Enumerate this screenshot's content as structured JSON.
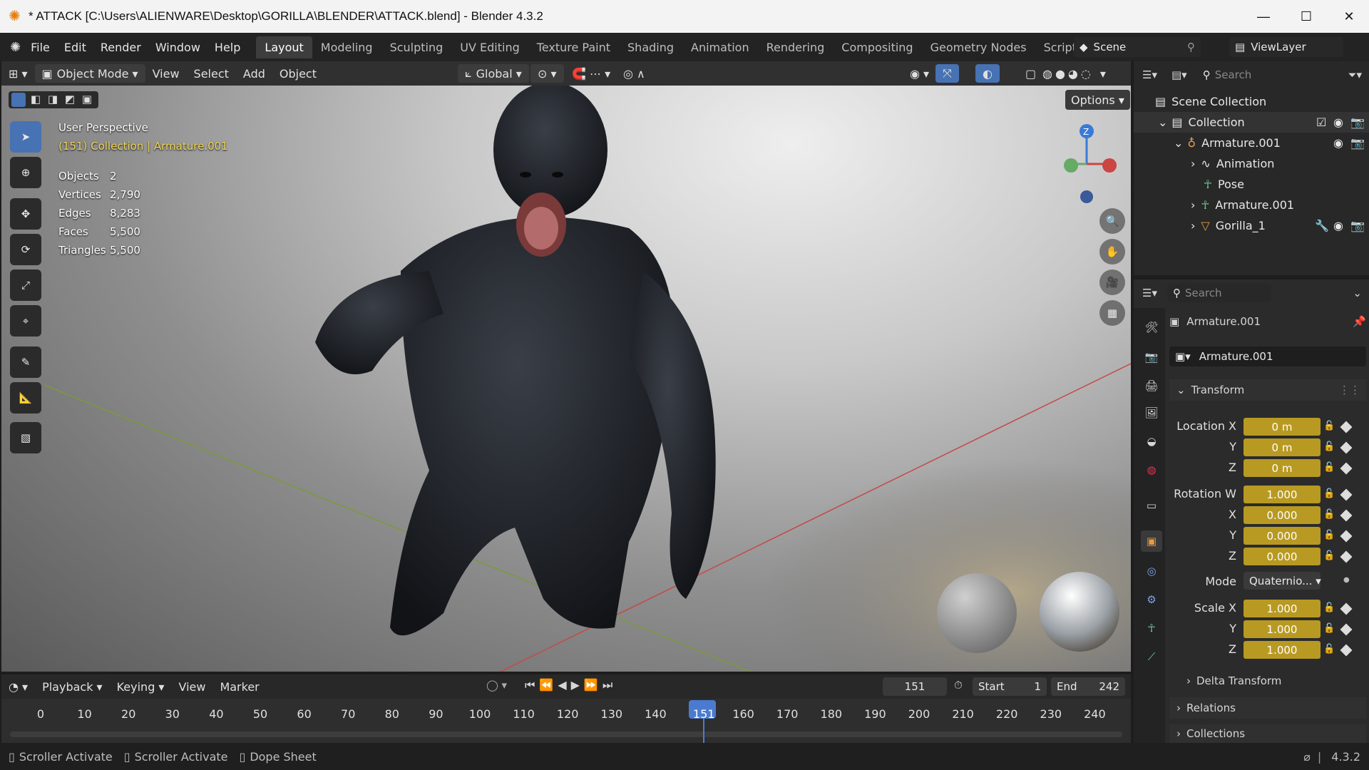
{
  "titlebar": {
    "title": "* ATTACK [C:\\Users\\ALIENWARE\\Desktop\\GORILLA\\BLENDER\\ATTACK.blend] - Blender 4.3.2",
    "minimize": "—",
    "maximize": "☐",
    "close": "✕"
  },
  "menu": {
    "items": [
      "File",
      "Edit",
      "Render",
      "Window",
      "Help"
    ]
  },
  "workspaces": {
    "tabs": [
      "Layout",
      "Modeling",
      "Sculpting",
      "UV Editing",
      "Texture Paint",
      "Shading",
      "Animation",
      "Rendering",
      "Compositing",
      "Geometry Nodes",
      "Scripting"
    ],
    "active": "Layout",
    "add": "+"
  },
  "scene": {
    "label": "Scene",
    "viewlayer": "ViewLayer"
  },
  "viewport_header": {
    "mode": "Object Mode",
    "menus": [
      "View",
      "Select",
      "Add",
      "Object"
    ],
    "orientation": "Global",
    "options": "Options"
  },
  "overlay": {
    "perspective": "User Perspective",
    "collection_info": "(151) Collection | Armature.001",
    "stats": [
      {
        "label": "Objects",
        "value": "2"
      },
      {
        "label": "Vertices",
        "value": "2,790"
      },
      {
        "label": "Edges",
        "value": "8,283"
      },
      {
        "label": "Faces",
        "value": "5,500"
      },
      {
        "label": "Triangles",
        "value": "5,500"
      }
    ]
  },
  "gizmo": {
    "z": "Z"
  },
  "outliner": {
    "search_placeholder": "Search",
    "items": [
      {
        "label": "Scene Collection",
        "indent": 0
      },
      {
        "label": "Collection",
        "indent": 1
      },
      {
        "label": "Armature.001",
        "indent": 2
      },
      {
        "label": "Animation",
        "indent": 3
      },
      {
        "label": "Pose",
        "indent": 3
      },
      {
        "label": "Armature.001",
        "indent": 3
      },
      {
        "label": "Gorilla_1",
        "indent": 3
      }
    ]
  },
  "properties": {
    "search_placeholder": "Search",
    "object_name": "Armature.001",
    "datablock": "Armature.001",
    "transform": {
      "header": "Transform",
      "location": {
        "label": "Location X",
        "x": "0 m",
        "y": "0 m",
        "z": "0 m"
      },
      "rotation": {
        "label": "Rotation W",
        "w": "1.000",
        "x": "0.000",
        "y": "0.000",
        "z": "0.000"
      },
      "mode": {
        "label": "Mode",
        "value": "Quaternio..."
      },
      "scale": {
        "label": "Scale X",
        "x": "1.000",
        "y": "1.000",
        "z": "1.000"
      },
      "axis_y": "Y",
      "axis_z": "Z",
      "axis_x": "X"
    },
    "sections": [
      "Delta Transform",
      "Relations",
      "Collections"
    ]
  },
  "timeline": {
    "menus": [
      "Playback",
      "Keying",
      "View",
      "Marker"
    ],
    "current_frame": "151",
    "start_label": "Start",
    "start": "1",
    "end_label": "End",
    "end": "242",
    "ticks": [
      "0",
      "10",
      "20",
      "30",
      "40",
      "50",
      "60",
      "70",
      "80",
      "90",
      "100",
      "110",
      "120",
      "130",
      "140",
      "151",
      "160",
      "170",
      "180",
      "190",
      "200",
      "210",
      "220",
      "230",
      "240"
    ]
  },
  "statusbar": {
    "items": [
      "Scroller Activate",
      "Scroller Activate",
      "Dope Sheet"
    ],
    "version": "4.3.2"
  }
}
